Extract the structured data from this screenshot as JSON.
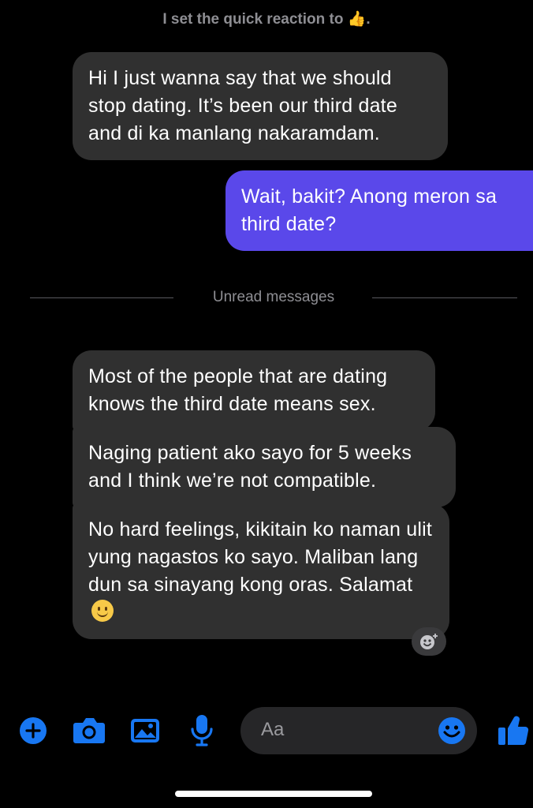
{
  "system": {
    "text": "I set the quick reaction to",
    "emoji": "👍",
    "end": "."
  },
  "messages": {
    "m1": "Hi I just wanna say that we should stop dating. It’s been our third date and di ka manlang nakaramdam.",
    "m2": "Wait, bakit? Anong meron sa third date?",
    "m3": "Most of the people that are dating knows the third date means sex.",
    "m4": "Naging patient ako sayo for 5 weeks and I think we’re not compatible.",
    "m5": "No hard feelings, kikitain ko naman ulit yung nagastos ko sayo. Maliban lang dun sa sinayang kong oras. Salamat"
  },
  "divider": {
    "label": "Unread messages"
  },
  "composer": {
    "placeholder": "Aa"
  },
  "colors": {
    "accent": "#1877F2",
    "outgoing": "#5a48ea",
    "incoming": "#303030"
  },
  "icons": [
    "plus-icon",
    "camera-icon",
    "image-icon",
    "mic-icon",
    "emoji-icon",
    "like-icon",
    "add-reaction-icon"
  ]
}
